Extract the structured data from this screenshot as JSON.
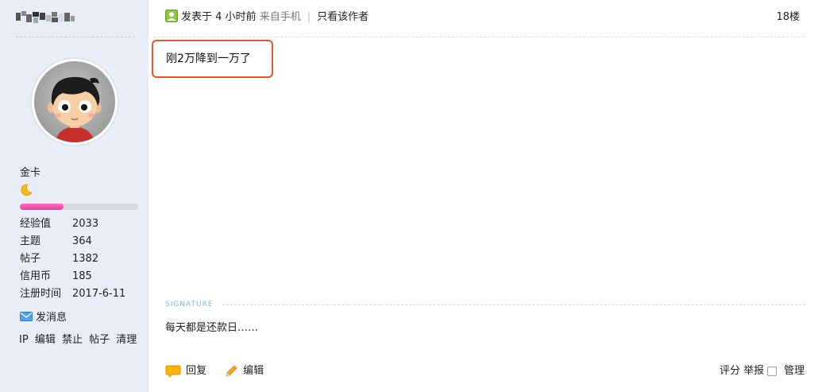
{
  "sidebar": {
    "rank_title": "金卡",
    "exp_progress": 0.37,
    "stats": [
      {
        "label": "经验值",
        "value": "2033"
      },
      {
        "label": "主题",
        "value": "364"
      },
      {
        "label": "帖子",
        "value": "1382"
      },
      {
        "label": "信用币",
        "value": "185"
      },
      {
        "label": "注册时间",
        "value": "2017-6-11"
      }
    ],
    "pm_label": "发消息",
    "admin_links": [
      "IP",
      "编辑",
      "禁止",
      "帖子",
      "清理"
    ]
  },
  "post": {
    "posted": "发表于 4 小时前",
    "source": "来自手机",
    "only_author": "只看该作者",
    "floor": "18楼",
    "content": "刚2万降到一万了",
    "signature_label": "SIGNATURE",
    "signature": "每天都是还款日……"
  },
  "actions": {
    "reply": "回复",
    "edit": "编辑",
    "rate": "评分",
    "report": "举报",
    "manage": "管理"
  },
  "colors": {
    "sidebar_bg": "#e9edf7",
    "highlight_border": "#e25a2c",
    "exp_bar": "#e43e9a",
    "signature_label": "#7fb7d8"
  },
  "icons": {
    "user": "user-icon",
    "moon": "moon-icon",
    "mail": "mail-icon",
    "reply": "speech-bubble-icon",
    "edit": "pencil-icon"
  }
}
